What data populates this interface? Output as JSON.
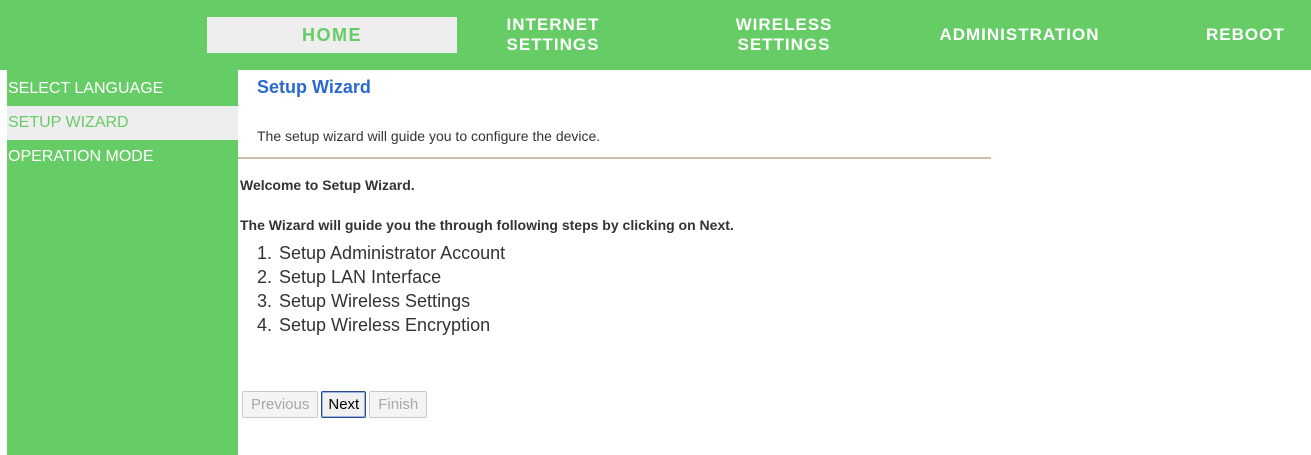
{
  "nav": {
    "items": [
      {
        "label": "HOME"
      },
      {
        "label": "INTERNET\nSETTINGS"
      },
      {
        "label": "WIRELESS\nSETTINGS"
      },
      {
        "label": "ADMINISTRATION"
      },
      {
        "label": "REBOOT"
      }
    ],
    "active": "HOME"
  },
  "sidebar": {
    "items": [
      {
        "label": "SELECT LANGUAGE"
      },
      {
        "label": "SETUP WIZARD"
      },
      {
        "label": "OPERATION MODE"
      }
    ],
    "active": "SETUP WIZARD"
  },
  "main": {
    "title": "Setup Wizard",
    "subtitle": "The setup wizard will guide you to configure the device.",
    "welcome": "Welcome to Setup Wizard.",
    "intro": "The Wizard will guide you the through following steps by clicking on Next.",
    "steps": [
      {
        "num": "1.",
        "text": "Setup Administrator Account"
      },
      {
        "num": "2.",
        "text": "Setup LAN Interface"
      },
      {
        "num": "3.",
        "text": "Setup Wireless Settings"
      },
      {
        "num": "4.",
        "text": "Setup Wireless Encryption"
      }
    ]
  },
  "buttons": {
    "previous": "Previous",
    "next": "Next",
    "finish": "Finish"
  },
  "colors": {
    "brand_green": "#66cc66",
    "title_blue": "#2a6ad0",
    "active_bg": "#eeeeee"
  }
}
